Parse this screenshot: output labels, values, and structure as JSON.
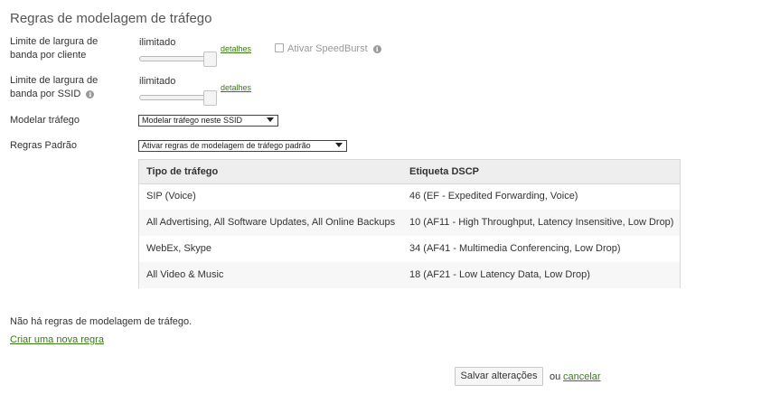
{
  "page": {
    "title": "Regras de modelagem de tráfego"
  },
  "bandwidth_per_client": {
    "label_line1": "Limite de largura de",
    "label_line2": "banda por cliente",
    "value": "ilimitado",
    "details_link": "detalhes",
    "speedburst_label": "Ativar SpeedBurst",
    "speedburst_checked": false
  },
  "bandwidth_per_ssid": {
    "label_line1": "Limite de largura de",
    "label_line2": "banda por SSID",
    "value": "ilimitado",
    "details_link": "detalhes"
  },
  "shape_traffic": {
    "label": "Modelar tráfego",
    "selected": "Modelar tráfego neste SSID"
  },
  "default_rules": {
    "label": "Regras Padrão",
    "selected": "Ativar regras de modelagem de tráfego padrão"
  },
  "rules_table": {
    "headers": [
      "Tipo de tráfego",
      "Etiqueta DSCP"
    ],
    "rows": [
      {
        "type": "SIP (Voice)",
        "dscp": "46 (EF - Expedited Forwarding, Voice)"
      },
      {
        "type": "All Advertising, All Software Updates, All Online Backups",
        "dscp": "10 (AF11 - High Throughput, Latency Insensitive, Low Drop)"
      },
      {
        "type": "WebEx, Skype",
        "dscp": "34 (AF41 - Multimedia Conferencing, Low Drop)"
      },
      {
        "type": "All Video & Music",
        "dscp": "18 (AF21 - Low Latency Data, Low Drop)"
      }
    ]
  },
  "no_rules_text": "Não há regras de modelagem de tráfego.",
  "create_rule_link": "Criar uma nova regra",
  "footer": {
    "save_button": "Salvar alterações",
    "or_text": "ou",
    "cancel_link": "cancelar"
  },
  "colors": {
    "link": "#3a7a18",
    "header_bg": "#eeeeee",
    "alt_row_bg": "#f7f7f7"
  }
}
